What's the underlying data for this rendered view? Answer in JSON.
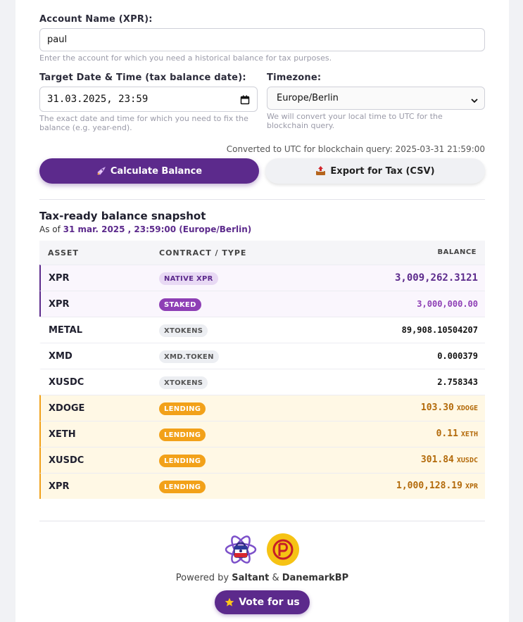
{
  "form": {
    "account_label": "Account Name (XPR):",
    "account_value": "paul",
    "account_help": "Enter the account for which you need a historical balance for tax purposes.",
    "date_label": "Target Date & Time (tax balance date):",
    "date_value": "31.03.2025, 23:59",
    "date_help": "The exact date and time for which you need to fix the balance (e.g. year-end).",
    "timezone_label": "Timezone:",
    "timezone_value": "Europe/Berlin",
    "timezone_help": "We will convert your local time to UTC for the blockchain query.",
    "utc_note": "Converted to UTC for blockchain query: 2025-03-31 21:59:00"
  },
  "actions": {
    "calculate_label": "Calculate Balance",
    "calculate_icon": "rocket-icon",
    "export_label": "Export for Tax (CSV)",
    "export_icon": "outbox-tray-icon"
  },
  "snapshot": {
    "title": "Tax-ready balance snapshot",
    "as_of_prefix": "As of",
    "as_of_value": "31 mar. 2025 , 23:59:00 (Europe/Berlin)"
  },
  "table": {
    "headers": [
      "ASSET",
      "CONTRACT / TYPE",
      "BALANCE"
    ],
    "rows": [
      {
        "asset": "XPR",
        "type": "NATIVE XPR",
        "balance": "3,009,262.3121",
        "suffix": "",
        "kind": "native"
      },
      {
        "asset": "XPR",
        "type": "STAKED",
        "balance": "3,000,000.00",
        "suffix": "",
        "kind": "staked"
      },
      {
        "asset": "METAL",
        "type": "XTOKENS",
        "balance": "89,908.10504207",
        "suffix": "",
        "kind": "xtokens"
      },
      {
        "asset": "XMD",
        "type": "XMD.TOKEN",
        "balance": "0.000379",
        "suffix": "",
        "kind": "xtokens"
      },
      {
        "asset": "XUSDC",
        "type": "XTOKENS",
        "balance": "2.758343",
        "suffix": "",
        "kind": "xtokens"
      },
      {
        "asset": "XDOGE",
        "type": "LENDING",
        "balance": "103.30",
        "suffix": "XDOGE",
        "kind": "lending"
      },
      {
        "asset": "XETH",
        "type": "LENDING",
        "balance": "0.11",
        "suffix": "XETH",
        "kind": "lending"
      },
      {
        "asset": "XUSDC",
        "type": "LENDING",
        "balance": "301.84",
        "suffix": "XUSDC",
        "kind": "lending"
      },
      {
        "asset": "XPR",
        "type": "LENDING",
        "balance": "1,000,128.19",
        "suffix": "XPR",
        "kind": "lending"
      }
    ]
  },
  "footer": {
    "powered_prefix": "Powered by",
    "powered_by_1": "Saltant",
    "ampersand": "&",
    "powered_by_2": "DanemarkBP",
    "vote_label": "Vote for us",
    "vote_icon": "star-icon",
    "logo_1": "saltant-atom-logo",
    "logo_2": "danemarkbp-logo"
  },
  "colors": {
    "brand_purple": "#5c2a8c",
    "lending_orange": "#f2a119",
    "lending_text": "#b36a0a",
    "page_bg": "#f1f2f5"
  }
}
